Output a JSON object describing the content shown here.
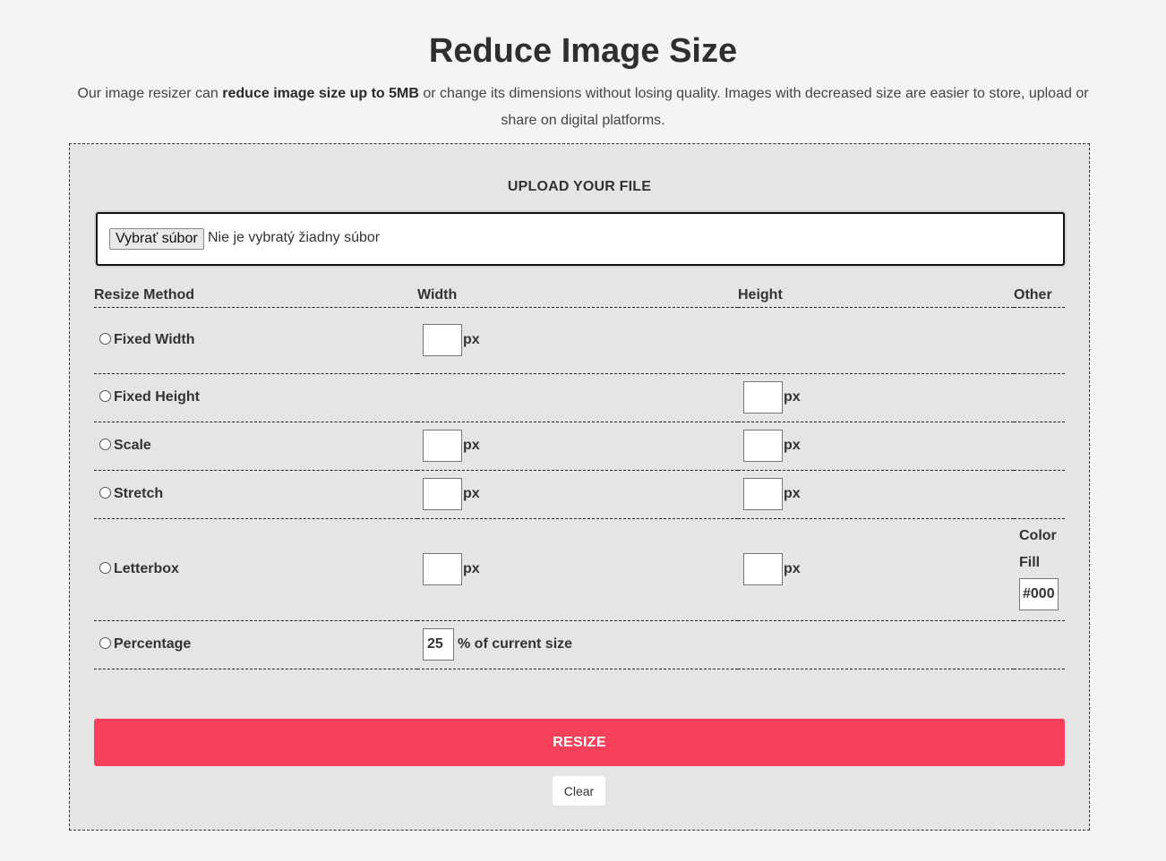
{
  "page": {
    "title": "Reduce Image Size",
    "intro_prefix": "Our image resizer can ",
    "intro_bold": "reduce image size up to 5MB",
    "intro_suffix": " or change its dimensions without losing quality. Images with decreased size are easier to store, upload or share on digital platforms."
  },
  "upload": {
    "heading": "UPLOAD YOUR FILE",
    "choose_button": "Vybrať súbor",
    "status": "Nie je vybratý žiadny súbor"
  },
  "table": {
    "headers": {
      "method": "Resize Method",
      "width": "Width",
      "height": "Height",
      "other": "Other"
    },
    "unit": "px",
    "rows": {
      "fixed_width": {
        "label": "Fixed Width"
      },
      "fixed_height": {
        "label": "Fixed Height"
      },
      "scale": {
        "label": "Scale"
      },
      "stretch": {
        "label": "Stretch"
      },
      "letterbox": {
        "label": "Letterbox",
        "color_fill_label": "Color Fill",
        "color_value": "#000"
      },
      "percentage": {
        "label": "Percentage",
        "value": "25",
        "suffix": "% of current size"
      }
    }
  },
  "actions": {
    "resize": "RESIZE",
    "clear": "Clear"
  },
  "colors": {
    "resize_button": "#f7415a",
    "panel_bg": "#e5e5e5",
    "page_bg": "#f4f4f4"
  }
}
